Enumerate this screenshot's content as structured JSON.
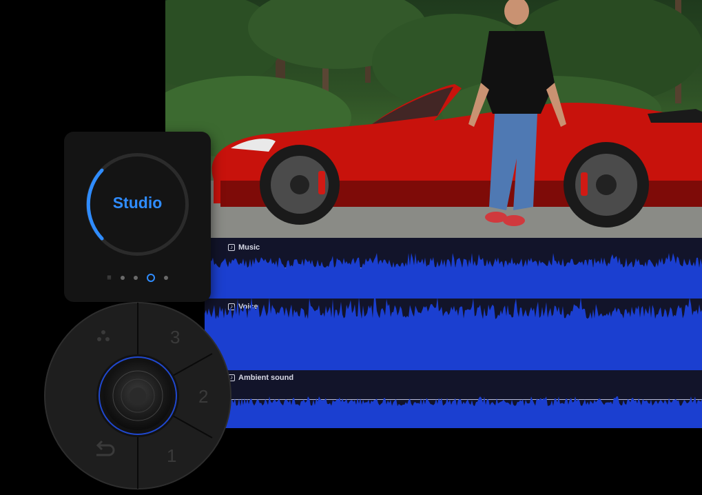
{
  "studio": {
    "mode_label": "Studio",
    "page_dots": [
      "menu",
      "dot",
      "dot",
      "active",
      "dot"
    ],
    "accent_color": "#2f8cff"
  },
  "tracks": [
    {
      "label": "Music",
      "icon": "music-note-icon"
    },
    {
      "label": "Voice",
      "icon": "music-note-icon"
    },
    {
      "label": "Ambient sound",
      "icon": "music-note-icon"
    }
  ],
  "dial": {
    "segments": [
      "3",
      "2",
      "1"
    ],
    "icons": [
      "dots-icon",
      "back-arrow-icon"
    ]
  },
  "colors": {
    "waveform": "#1b3fd0",
    "editor_bg": "#12142a",
    "car": "#c8120c"
  }
}
